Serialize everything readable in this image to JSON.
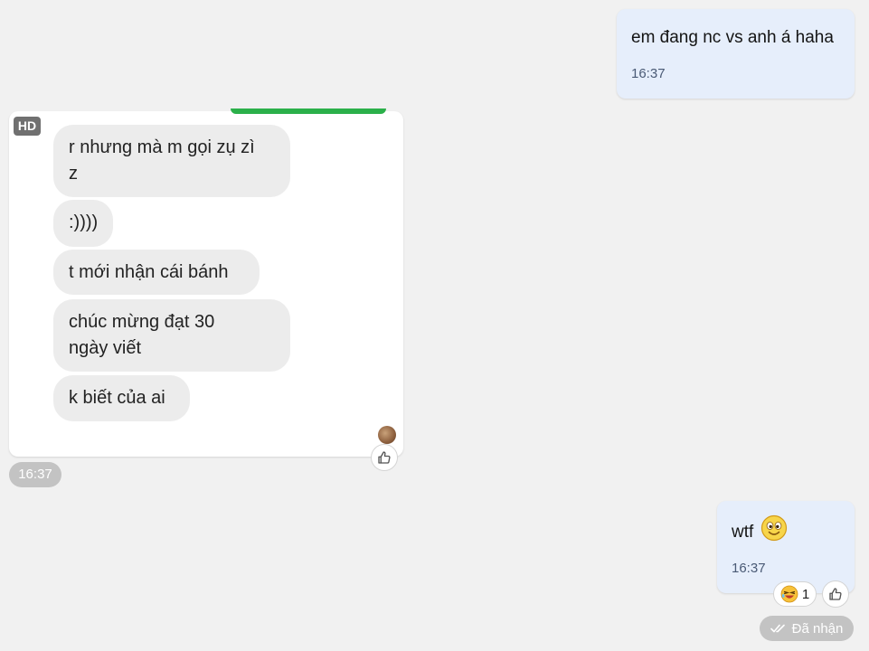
{
  "messages": {
    "outgoing_1": {
      "text": "em đang nc vs anh á haha",
      "time": "16:37"
    },
    "incoming_image": {
      "badge": "HD",
      "bubbles": [
        {
          "lines": [
            "r nhưng mà m gọi zụ zì",
            "z"
          ]
        },
        {
          "lines": [
            ":))))"
          ]
        },
        {
          "lines": [
            "t mới nhận cái bánh"
          ]
        },
        {
          "lines": [
            "chúc mừng đạt 30",
            "ngày viết"
          ]
        },
        {
          "lines": [
            "k biết của ai"
          ]
        }
      ],
      "time": "16:37"
    },
    "outgoing_2": {
      "text": "wtf",
      "emoji": "smiley-emoji",
      "time": "16:37",
      "reaction": {
        "icon": "laughing-emoji-icon",
        "count": "1"
      },
      "status": "Đã nhận"
    }
  },
  "icons": {
    "like": "thumbs-up-icon",
    "status": "double-check-icon"
  },
  "colors": {
    "background": "#f1f1f1",
    "outgoing_bubble": "#e6eefb",
    "incoming_bubble": "#ececec",
    "accent_green": "#2bb04a",
    "pill_gray": "#c3c3c3"
  }
}
